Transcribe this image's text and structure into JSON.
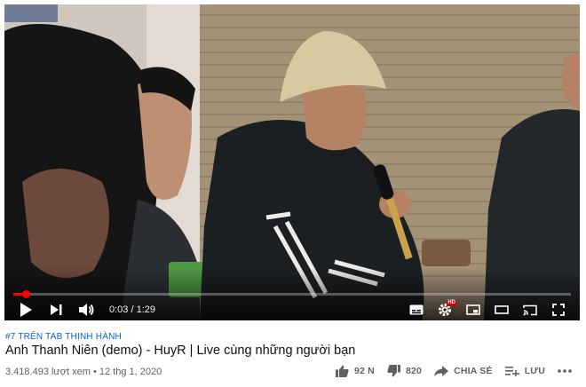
{
  "player": {
    "progress_fraction": 0.023,
    "time_current": "0:03",
    "time_separator": " / ",
    "time_total": "1:29",
    "accent_color": "#ff0000",
    "settings_badge": "HD"
  },
  "video": {
    "hashtag": "#7 TRÊN TAB THỊNH HÀNH",
    "title": "Anh Thanh Niên (demo) - HuyR | Live cùng những người bạn",
    "views": "3.418.493 lượt xem",
    "meta_separator": " • ",
    "date": "12 thg 1, 2020"
  },
  "actions": {
    "like_count": "92 N",
    "dislike_count": "820",
    "share_label": "CHIA SẺ",
    "save_label": "LƯU"
  }
}
